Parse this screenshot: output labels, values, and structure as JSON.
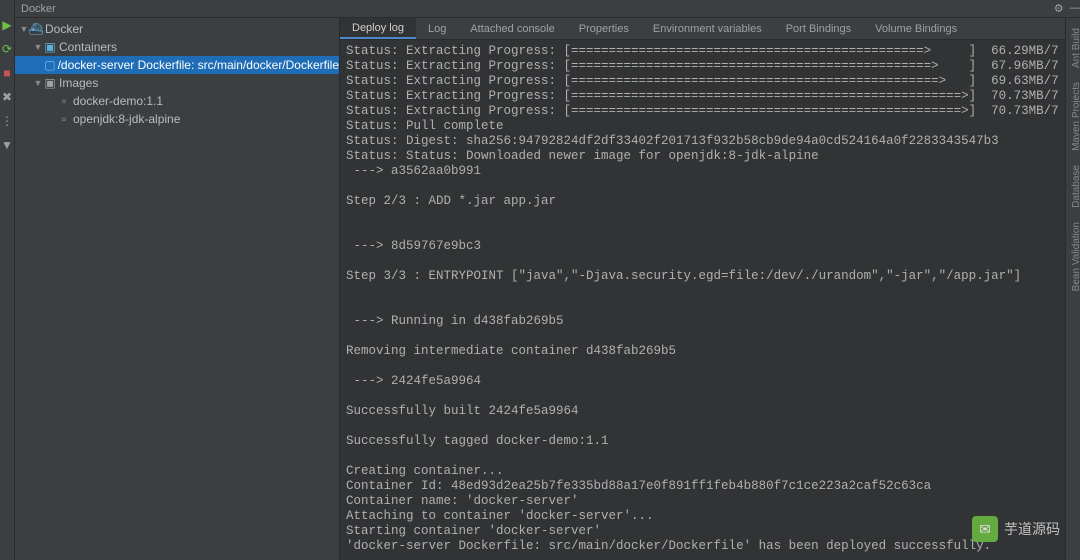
{
  "title": "Docker",
  "left_tool_icons": [
    "▶",
    "⟳",
    "■",
    "✖",
    "⋮",
    "▼"
  ],
  "tree": {
    "root": {
      "label": "Docker",
      "cls": "#5fb0df"
    },
    "containers_label": "Containers",
    "container_selected": "/docker-server Dockerfile: src/main/docker/Dockerfile",
    "images_label": "Images",
    "image_items": [
      "docker-demo:1.1",
      "openjdk:8-jdk-alpine"
    ]
  },
  "tabs": [
    "Deploy log",
    "Log",
    "Attached console",
    "Properties",
    "Environment variables",
    "Port Bindings",
    "Volume Bindings"
  ],
  "active_tab_index": 0,
  "right_tabs": [
    "Ant Build",
    "Maven Projects",
    "Database",
    "Bean Validation"
  ],
  "log_lines": [
    "Status: Extracting Progress: [===============================================>     ]  66.29MB/7",
    "Status: Extracting Progress: [================================================>    ]  67.96MB/7",
    "Status: Extracting Progress: [=================================================>   ]  69.63MB/7",
    "Status: Extracting Progress: [====================================================>]  70.73MB/7",
    "Status: Extracting Progress: [====================================================>]  70.73MB/7",
    "Status: Pull complete",
    "Status: Digest: sha256:94792824df2df33402f201713f932b58cb9de94a0cd524164a0f2283343547b3",
    "Status: Status: Downloaded newer image for openjdk:8-jdk-alpine",
    " ---> a3562aa0b991",
    "",
    "Step 2/3 : ADD *.jar app.jar",
    "",
    "",
    " ---> 8d59767e9bc3",
    "",
    "Step 3/3 : ENTRYPOINT [\"java\",\"-Djava.security.egd=file:/dev/./urandom\",\"-jar\",\"/app.jar\"]",
    "",
    "",
    " ---> Running in d438fab269b5",
    "",
    "Removing intermediate container d438fab269b5",
    "",
    " ---> 2424fe5a9964",
    "",
    "Successfully built 2424fe5a9964",
    "",
    "Successfully tagged docker-demo:1.1",
    "",
    "Creating container...",
    "Container Id: 48ed93d2ea25b7fe335bd88a17e0f891ff1feb4b880f7c1ce223a2caf52c63ca",
    "Container name: 'docker-server'",
    "Attaching to container 'docker-server'...",
    "Starting container 'docker-server'",
    "'docker-server Dockerfile: src/main/docker/Dockerfile' has been deployed successfully."
  ],
  "watermark": "芋道源码"
}
